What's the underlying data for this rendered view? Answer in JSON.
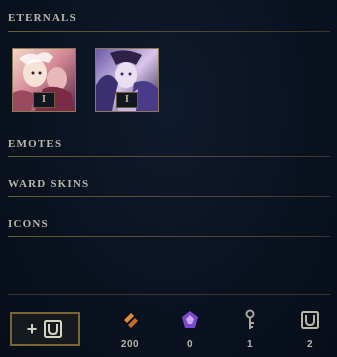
{
  "sections": {
    "eternals": {
      "title": "Eternals"
    },
    "emotes": {
      "title": "Emotes"
    },
    "ward_skins": {
      "title": "Ward Skins"
    },
    "icons": {
      "title": "Icons"
    }
  },
  "eternals": [
    {
      "tier": "I",
      "icon": "eternal-champion-portrait-1"
    },
    {
      "tier": "I",
      "icon": "eternal-champion-portrait-2"
    }
  ],
  "footer": {
    "add_button": {
      "plus": "+",
      "icon": "loot-chest-icon"
    },
    "currencies": [
      {
        "name": "orange-essence",
        "icon": "orange-essence-icon",
        "value": "200",
        "color": "#e08a3a"
      },
      {
        "name": "mythic-essence",
        "icon": "mythic-essence-icon",
        "value": "0",
        "color": "#b07cf0"
      },
      {
        "name": "key",
        "icon": "key-icon",
        "value": "1",
        "color": "#a9a69a"
      },
      {
        "name": "chest",
        "icon": "chest-icon",
        "value": "2",
        "color": "#b9b6a6"
      }
    ]
  }
}
